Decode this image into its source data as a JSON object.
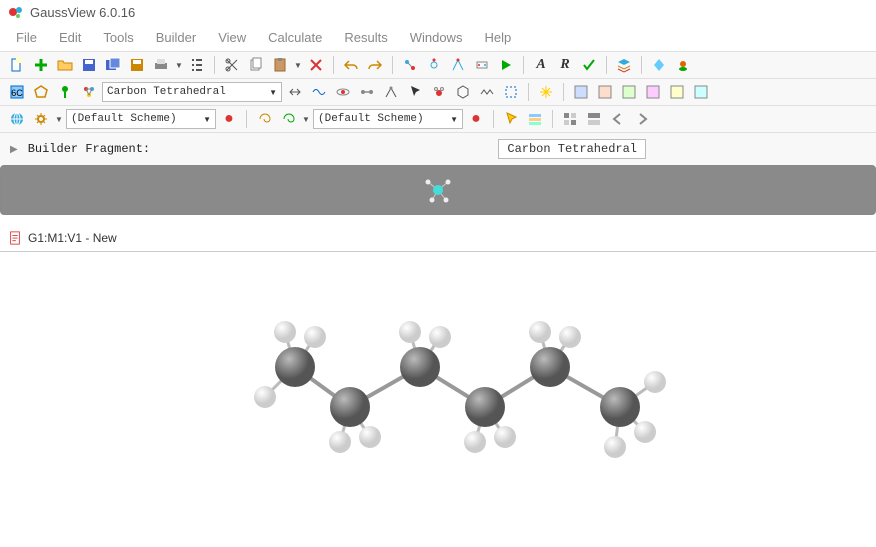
{
  "app": {
    "title": "GaussView 6.0.16"
  },
  "menus": [
    "File",
    "Edit",
    "Tools",
    "Builder",
    "View",
    "Calculate",
    "Results",
    "Windows",
    "Help"
  ],
  "toolbar1_icons": [
    "new",
    "plus",
    "open",
    "save",
    "save-multi",
    "save-alt",
    "printer",
    "list",
    "sep",
    "scissors",
    "clipboard",
    "paste",
    "delete",
    "sep",
    "undo",
    "redo",
    "sep",
    "opt1",
    "opt2",
    "opt3",
    "opt4",
    "run",
    "bold-a",
    "italic-r",
    "check",
    "sep",
    "layers",
    "sep",
    "diamond",
    "ball"
  ],
  "toolbar2": {
    "left_icons": [
      "element-c",
      "ring",
      "pin",
      "fragment"
    ],
    "dropdown1": "Carbon Tetrahedral",
    "mid_icons": [
      "link",
      "wave",
      "atom",
      "bond1",
      "bond2",
      "arrow",
      "water",
      "hex",
      "zigzag",
      "select",
      "sep",
      "sparkle",
      "sep",
      "grid1",
      "grid2",
      "grid3",
      "grid4",
      "grid5",
      "grid6"
    ]
  },
  "toolbar3": {
    "left_icons": [
      "globe",
      "settings"
    ],
    "dropdown1": "(Default Scheme)",
    "mid_marker": "●",
    "mid_icons": [
      "spiral",
      "spiral2"
    ],
    "dropdown2": "(Default Scheme)",
    "mid_marker2": "●",
    "right_icons": [
      "pointer",
      "config",
      "sep",
      "grid-a",
      "grid-b",
      "arrow-l",
      "arrow-r"
    ]
  },
  "builder": {
    "label": "Builder Fragment:",
    "tag": "Carbon Tetrahedral"
  },
  "document": {
    "title": "G1:M1:V1 - New"
  }
}
